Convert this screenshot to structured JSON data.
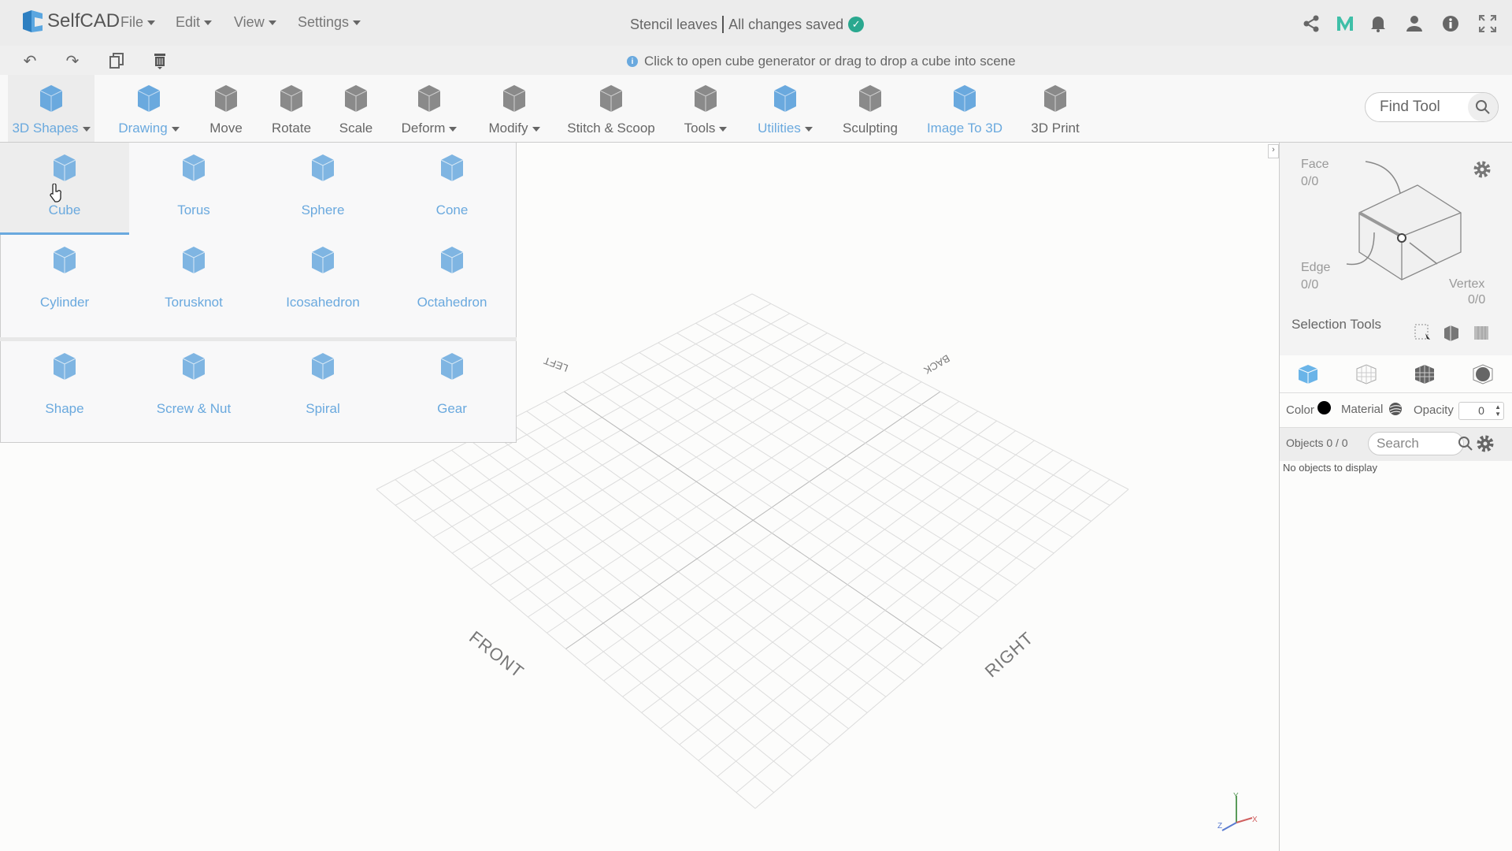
{
  "app": {
    "name": "SelfCAD",
    "menus": [
      "File",
      "Edit",
      "View",
      "Settings"
    ],
    "document_title": "Stencil leaves",
    "save_status": "All changes saved"
  },
  "header_icons": [
    "share-icon",
    "m-logo-icon",
    "bell-icon",
    "user-icon",
    "info-icon",
    "fullscreen-icon"
  ],
  "hint": "Click to open cube generator or drag to drop a cube into scene",
  "toolbar": {
    "items": [
      {
        "label": "3D Shapes",
        "dropdown": true,
        "active": true
      },
      {
        "label": "Drawing",
        "dropdown": true,
        "active": true
      },
      {
        "label": "Move",
        "dropdown": false
      },
      {
        "label": "Rotate",
        "dropdown": false
      },
      {
        "label": "Scale",
        "dropdown": false
      },
      {
        "label": "Deform",
        "dropdown": true
      },
      {
        "label": "Modify",
        "dropdown": true
      },
      {
        "label": "Stitch & Scoop",
        "dropdown": false
      },
      {
        "label": "Tools",
        "dropdown": true
      },
      {
        "label": "Utilities",
        "dropdown": true,
        "active": true
      },
      {
        "label": "Sculpting",
        "dropdown": false
      },
      {
        "label": "Image To 3D",
        "dropdown": false,
        "active": true
      },
      {
        "label": "3D Print",
        "dropdown": false
      }
    ],
    "find_placeholder": "Find Tool"
  },
  "shapes": [
    "Cube",
    "Torus",
    "Sphere",
    "Cone",
    "Cylinder",
    "Torusknot",
    "Icosahedron",
    "Octahedron",
    "Shape",
    "Screw & Nut",
    "Spiral",
    "Gear"
  ],
  "viewport": {
    "labels": {
      "front": "FRONT",
      "right": "RIGHT",
      "left": "LEFT",
      "back": "BACK"
    },
    "axes": {
      "x": "X",
      "y": "Y",
      "z": "Z"
    }
  },
  "panel": {
    "face": "Face",
    "face_count": "0/0",
    "edge": "Edge",
    "edge_count": "0/0",
    "vertex": "Vertex",
    "vertex_count": "0/0",
    "selection_tools": "Selection Tools",
    "color": "Color",
    "material": "Material",
    "opacity": "Opacity",
    "opacity_value": "0",
    "objects": "Objects 0 / 0",
    "search_placeholder": "Search",
    "empty": "No objects to display",
    "accent": "#6aa9de"
  }
}
